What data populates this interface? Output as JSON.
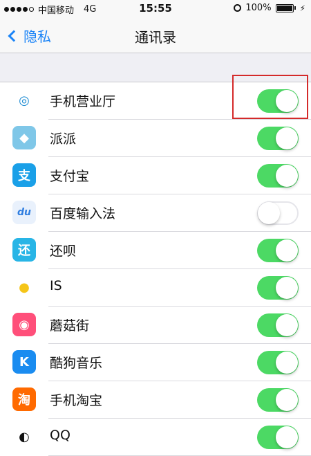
{
  "status": {
    "carrier": "中国移动",
    "network": "4G",
    "time": "15:55",
    "battery": "100%"
  },
  "nav": {
    "back_label": "隐私",
    "title": "通讯录"
  },
  "apps": [
    {
      "name": "手机营业厅",
      "enabled": true,
      "icon": "china-mobile-icon",
      "icon_color": "#ffffff"
    },
    {
      "name": "派派",
      "enabled": true,
      "icon": "paipai-icon",
      "icon_color": "#7fc7e8"
    },
    {
      "name": "支付宝",
      "enabled": true,
      "icon": "alipay-icon",
      "icon_color": "#1aa0e8"
    },
    {
      "name": "百度输入法",
      "enabled": false,
      "icon": "baidu-input-icon",
      "icon_color": "#2f7ee0"
    },
    {
      "name": "还呗",
      "enabled": true,
      "icon": "huanbei-icon",
      "icon_color": "#28b5e6"
    },
    {
      "name": "IS",
      "enabled": true,
      "icon": "is-icon",
      "icon_color": "#ffffff"
    },
    {
      "name": "蘑菇街",
      "enabled": true,
      "icon": "mogujie-icon",
      "icon_color": "#ff4f7a"
    },
    {
      "name": "酷狗音乐",
      "enabled": true,
      "icon": "kugou-icon",
      "icon_color": "#1a8cf0"
    },
    {
      "name": "手机淘宝",
      "enabled": true,
      "icon": "taobao-icon",
      "icon_color": "#ff6a00"
    },
    {
      "name": "QQ",
      "enabled": true,
      "icon": "qq-icon",
      "icon_color": "#ffffff"
    }
  ],
  "colors": {
    "toggle_on": "#4cd964",
    "accent": "#1b84f7",
    "highlight_box": "#d42a2a"
  }
}
